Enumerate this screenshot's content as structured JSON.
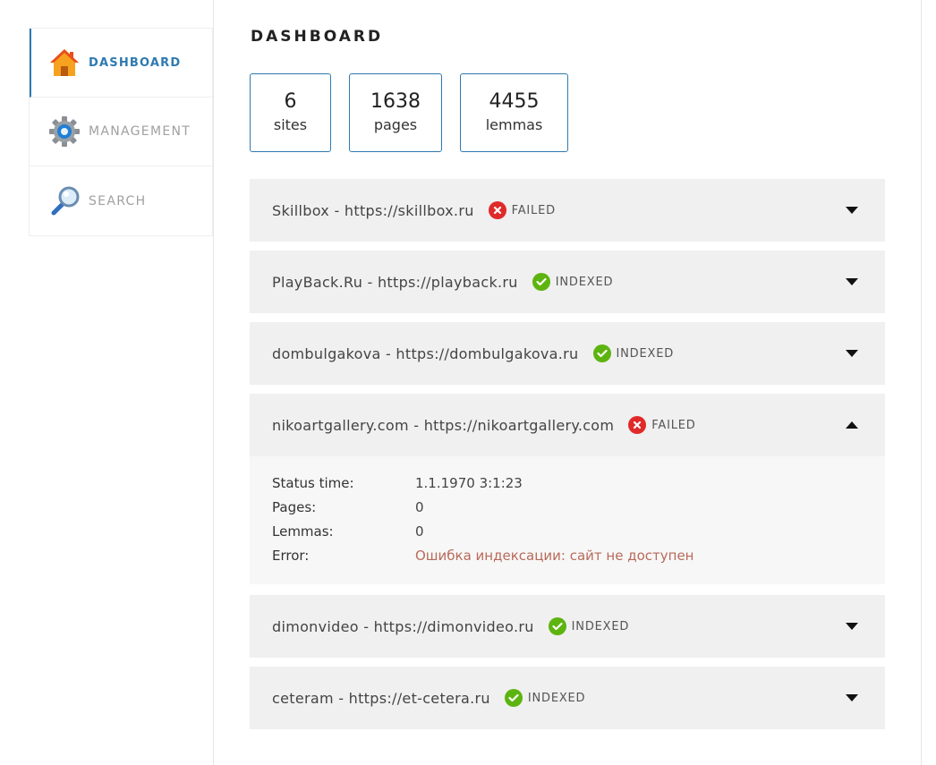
{
  "sidebar": {
    "items": [
      {
        "label": "DASHBOARD",
        "icon": "home-icon",
        "active": true
      },
      {
        "label": "MANAGEMENT",
        "icon": "gear-icon",
        "active": false
      },
      {
        "label": "SEARCH",
        "icon": "magnifier-icon",
        "active": false
      }
    ]
  },
  "page": {
    "title": "DASHBOARD"
  },
  "stats": [
    {
      "value": "6",
      "label": "sites"
    },
    {
      "value": "1638",
      "label": "pages"
    },
    {
      "value": "4455",
      "label": "lemmas"
    }
  ],
  "sites": [
    {
      "name": "Skillbox - https://skillbox.ru",
      "status": "FAILED",
      "expanded": false
    },
    {
      "name": "PlayBack.Ru - https://playback.ru",
      "status": "INDEXED",
      "expanded": false
    },
    {
      "name": "dombulgakova - https://dombulgakova.ru",
      "status": "INDEXED",
      "expanded": false
    },
    {
      "name": "nikoartgallery.com - https://nikoartgallery.com",
      "status": "FAILED",
      "expanded": true,
      "details": {
        "status_time_label": "Status time:",
        "status_time": "1.1.1970 3:1:23",
        "pages_label": "Pages:",
        "pages": "0",
        "lemmas_label": "Lemmas:",
        "lemmas": "0",
        "error_label": "Error:",
        "error": "Ошибка индексации: сайт не доступен"
      }
    },
    {
      "name": "dimonvideo - https://dimonvideo.ru",
      "status": "INDEXED",
      "expanded": false
    },
    {
      "name": "ceteram - https://et-cetera.ru",
      "status": "INDEXED",
      "expanded": false
    }
  ],
  "colors": {
    "accent": "#2e7ab1",
    "failed": "#e02a2a",
    "indexed": "#5db40f",
    "error_text": "#b86a5a"
  }
}
